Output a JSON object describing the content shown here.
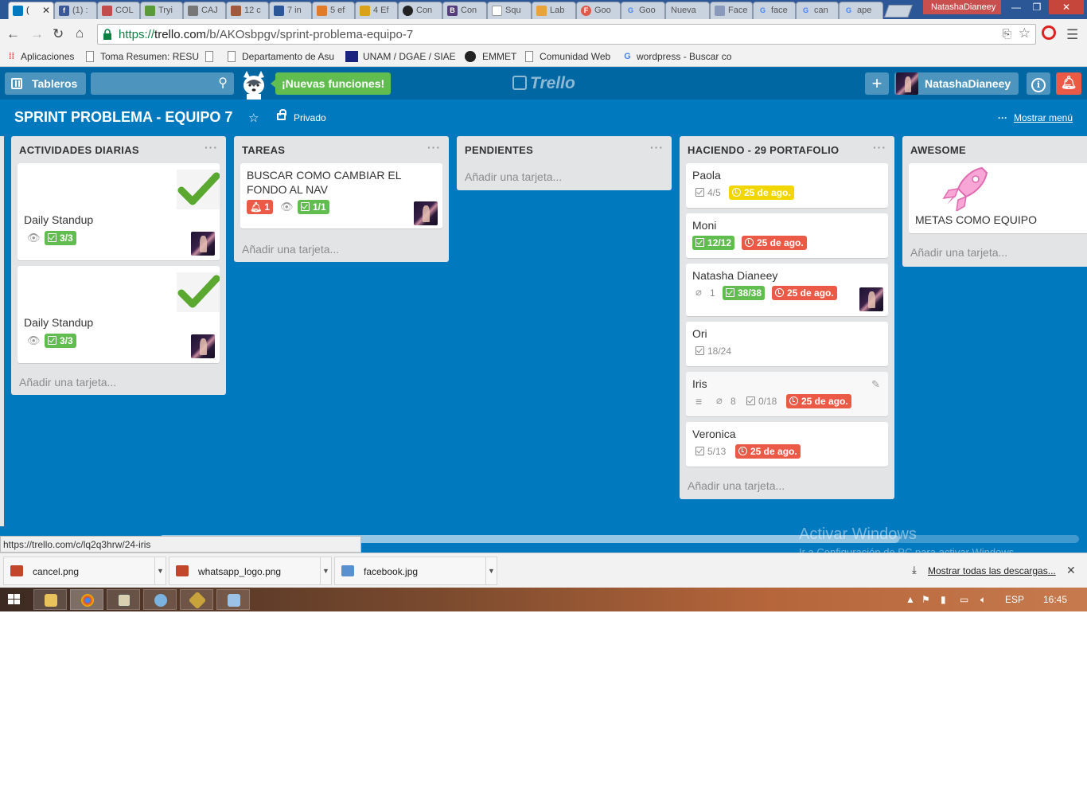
{
  "browser": {
    "tabs": [
      {
        "label": "(",
        "favicon_color": "#0079bf",
        "active": true
      },
      {
        "label": "(1) :",
        "favicon_color": "#3b5998"
      },
      {
        "label": "COL",
        "favicon_color": "#c24b4b"
      },
      {
        "label": "Tryi",
        "favicon_color": "#5a9a3a"
      },
      {
        "label": "CAJ",
        "favicon_color": "#777777"
      },
      {
        "label": "12 c",
        "favicon_color": "#a05a3a"
      },
      {
        "label": "7 in",
        "favicon_color": "#2b5797"
      },
      {
        "label": "5 ef",
        "favicon_color": "#e07b2a"
      },
      {
        "label": "4 Ef",
        "favicon_color": "#d9a21a"
      },
      {
        "label": "Con",
        "favicon_color": "#222222"
      },
      {
        "label": "Con",
        "favicon_color": "#563d7c"
      },
      {
        "label": "Squ",
        "favicon_color": "#aaaaaa"
      },
      {
        "label": "Lab",
        "favicon_color": "#e8a33a"
      },
      {
        "label": "Goo",
        "favicon_color": "#e05a4a"
      },
      {
        "label": "Goo",
        "favicon_color": "#4285f4"
      },
      {
        "label": "Nueva",
        "favicon_color": "#c9d2df"
      },
      {
        "label": "Face",
        "favicon_color": "#8899bb"
      },
      {
        "label": "face",
        "favicon_color": "#4285f4"
      },
      {
        "label": "can",
        "favicon_color": "#4285f4"
      },
      {
        "label": "ape",
        "favicon_color": "#4285f4"
      }
    ],
    "window_user": "NatashaDianeey",
    "url": {
      "scheme": "https://",
      "host": "trello.com",
      "path": "/b/AKOsbpgv/sprint-problema-equipo-7"
    },
    "bookmarks": [
      {
        "label": "Aplicaciones",
        "icon": "apps-grid-icon"
      },
      {
        "label": "Toma Resumen: RESU",
        "icon": "page-icon"
      },
      {
        "label": "",
        "icon": "page-icon"
      },
      {
        "label": "Departamento de Asu",
        "icon": "page-icon"
      },
      {
        "label": "UNAM / DGAE / SIAE",
        "icon": "unam-icon"
      },
      {
        "label": "EMMET",
        "icon": "emmet-icon"
      },
      {
        "label": "Comunidad Web",
        "icon": "page-icon"
      },
      {
        "label": "wordpress - Buscar co",
        "icon": "google-icon"
      }
    ]
  },
  "trello": {
    "boards_label": "Tableros",
    "new_features_label": "¡Nuevas funciones!",
    "logo_text": "Trello",
    "username": "NatashaDianeey",
    "board_title": "SPRINT PROBLEMA - EQUIPO 7",
    "privacy_label": "Privado",
    "show_menu_label": "Mostrar menú",
    "add_card_label": "Añadir una tarjeta...",
    "lists": [
      {
        "title": "ACTIVIDADES DIARIAS",
        "cards": [
          {
            "title": "Daily Standup",
            "checklist": "3/3"
          },
          {
            "title": "Daily Standup",
            "checklist": "3/3"
          }
        ]
      },
      {
        "title": "TAREAS",
        "cards": [
          {
            "title": "BUSCAR COMO CAMBIAR EL FONDO AL NAV",
            "notifications": "1",
            "checklist": "1/1"
          }
        ]
      },
      {
        "title": "PENDIENTES",
        "cards": []
      },
      {
        "title": "HACIENDO - 29 PORTAFOLIO",
        "cards": [
          {
            "title": "Paola",
            "checklist": "4/5",
            "due": "25 de ago."
          },
          {
            "title": "Moni",
            "checklist": "12/12",
            "due": "25 de ago."
          },
          {
            "title": "Natasha Dianeey",
            "attachments": "1",
            "checklist": "38/38",
            "due": "25 de ago."
          },
          {
            "title": "Ori",
            "checklist": "18/24"
          },
          {
            "title": "Iris",
            "attachments": "8",
            "checklist": "0/18",
            "due": "25 de ago."
          },
          {
            "title": "Veronica",
            "checklist": "5/13",
            "due": "25 de ago."
          }
        ]
      },
      {
        "title": "AWESOME",
        "cards": [
          {
            "title": "METAS COMO EQUIPO"
          }
        ]
      }
    ]
  },
  "status_url": "https://trello.com/c/lq2q3hrw/24-iris",
  "watermark": {
    "title": "Activar Windows",
    "subtitle": "Ir a Configuración de PC para activar Windows."
  },
  "downloads": {
    "files": [
      "cancel.png",
      "whatsapp_logo.png",
      "facebook.jpg"
    ],
    "show_all_label": "Mostrar todas las descargas..."
  },
  "taskbar": {
    "language": "ESP",
    "time": "16:45"
  },
  "colors": {
    "board_bg": "#0079bf",
    "header_bg": "#0067a3",
    "green_label": "#61bd4f",
    "red_label": "#eb5a46",
    "yellow_label": "#f2d600"
  }
}
